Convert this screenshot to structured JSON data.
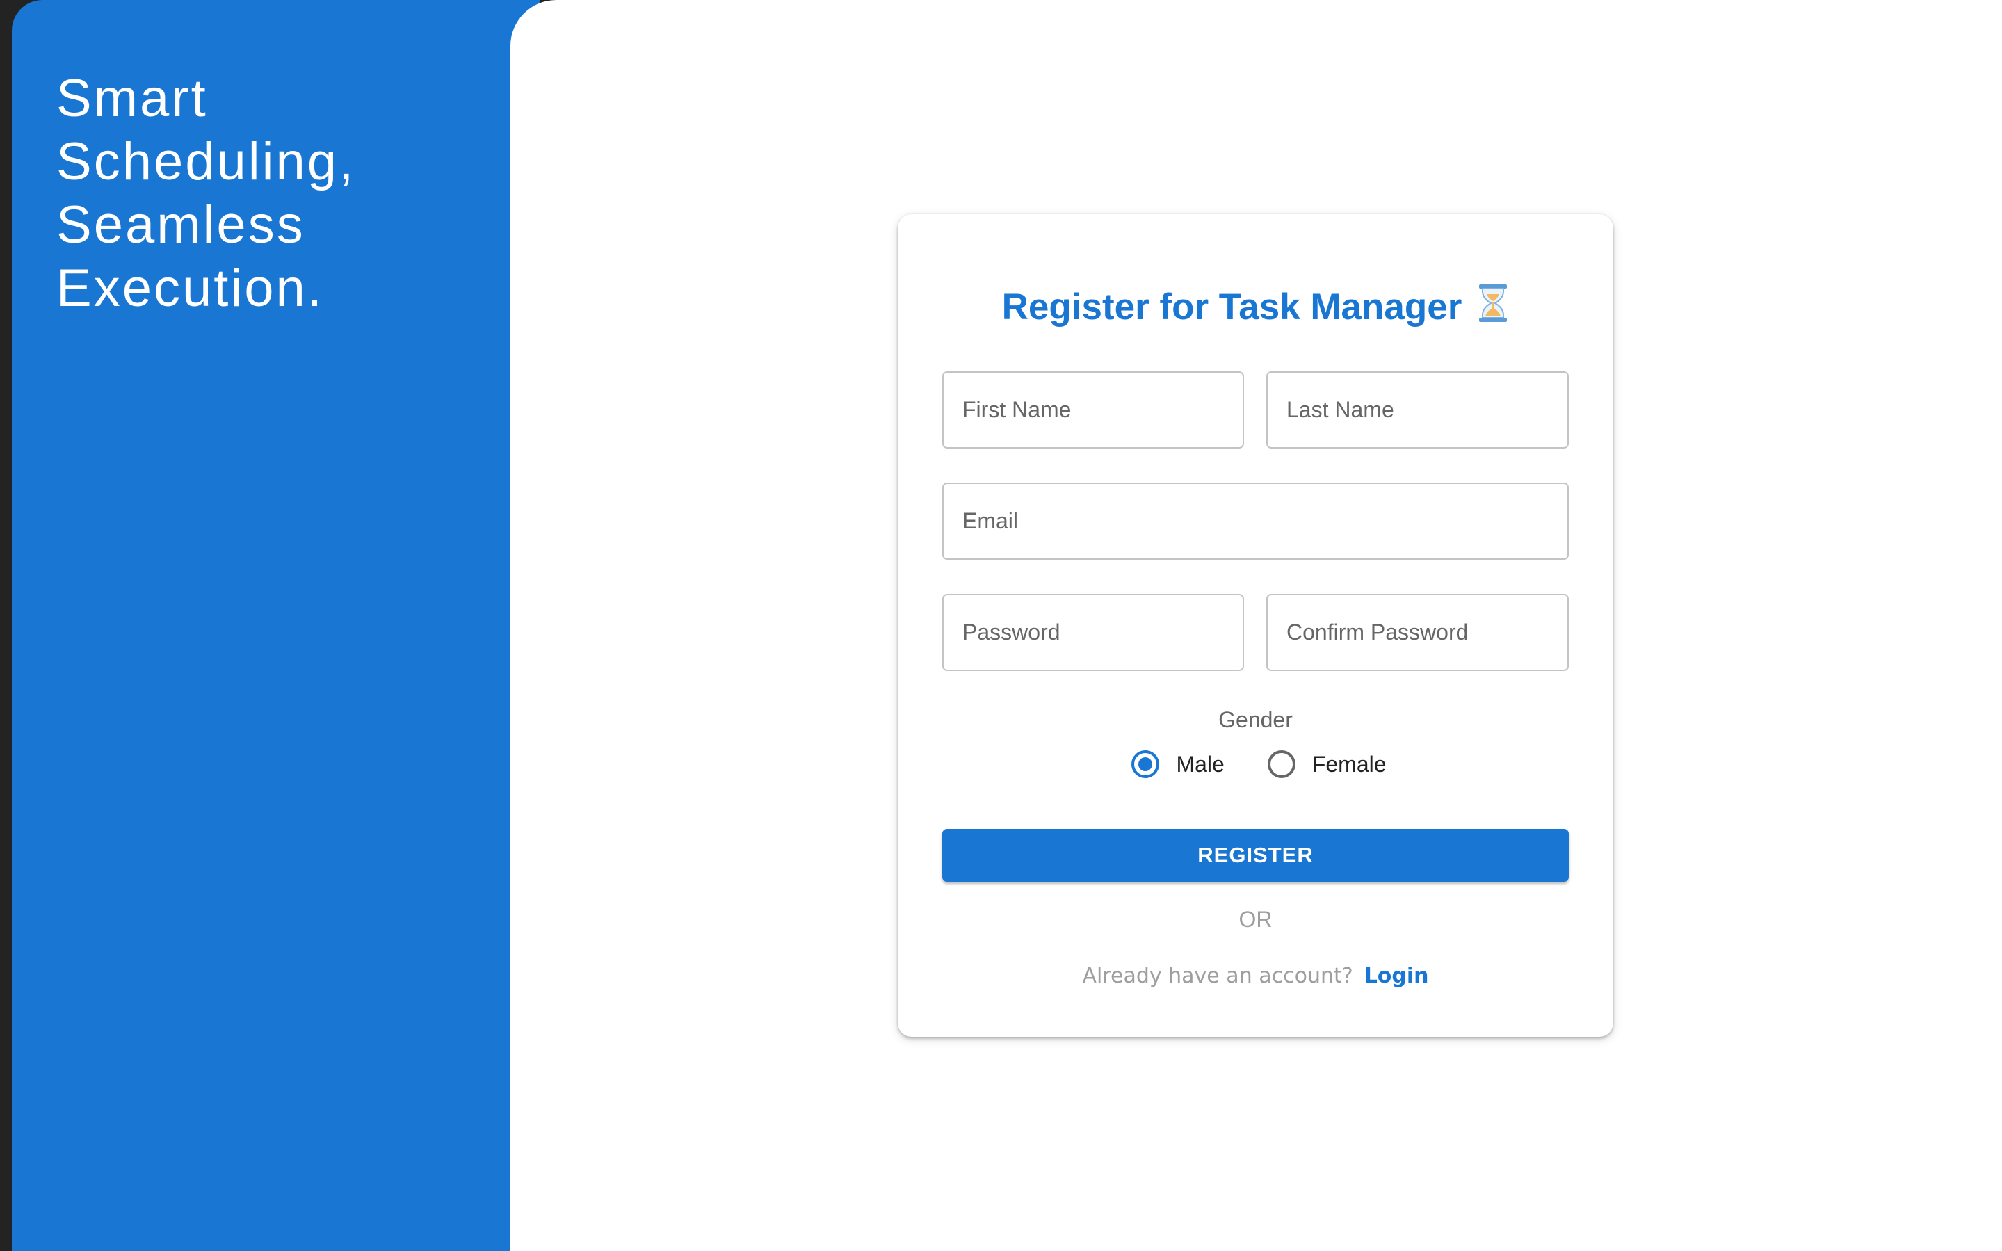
{
  "sidebar": {
    "tagline": "Smart\nScheduling,\nSeamless\nExecution."
  },
  "form": {
    "title": "Register for Task Manager",
    "title_icon": "hourglass-icon",
    "fields": {
      "first_name": {
        "label": "First Name",
        "value": ""
      },
      "last_name": {
        "label": "Last Name",
        "value": ""
      },
      "email": {
        "label": "Email",
        "value": ""
      },
      "password": {
        "label": "Password",
        "value": ""
      },
      "confirm_password": {
        "label": "Confirm Password",
        "value": ""
      }
    },
    "gender": {
      "label": "Gender",
      "options": [
        {
          "label": "Male",
          "selected": true
        },
        {
          "label": "Female",
          "selected": false
        }
      ]
    },
    "register_label": "REGISTER",
    "or_label": "OR",
    "login_prompt": "Already have an account?",
    "login_link": "Login"
  },
  "colors": {
    "primary": "#1976d2",
    "background_dark": "#232323",
    "label_gray": "#666666",
    "muted_gray": "#9e9e9e"
  }
}
